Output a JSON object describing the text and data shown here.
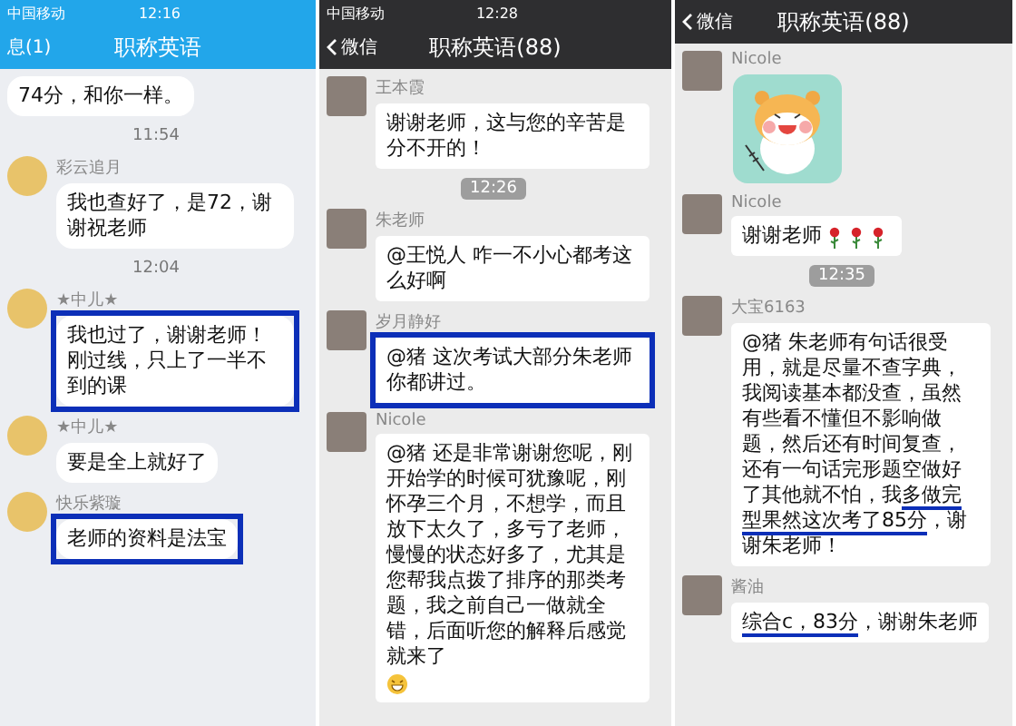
{
  "panels": [
    {
      "kind": "qq",
      "status_bar": {
        "carrier": "中国移动",
        "time": "12:16"
      },
      "header": {
        "back": "息(1)",
        "title": "职称英语"
      },
      "messages": [
        {
          "kind": "continued",
          "highlighted": false,
          "parts": [
            {
              "text": "74分，和你一样。",
              "underlined": false
            }
          ]
        },
        {
          "kind": "time",
          "text": "11:54"
        },
        {
          "kind": "text",
          "sender": "彩云追月",
          "highlighted": false,
          "parts": [
            {
              "text": "我也查好了，是72，谢谢祝老师",
              "underlined": false
            }
          ]
        },
        {
          "kind": "time",
          "text": "12:04"
        },
        {
          "kind": "text",
          "sender": "★中儿★",
          "highlighted": true,
          "parts": [
            {
              "text": "我也过了，谢谢老师！刚过线，只上了一半不到的课",
              "underlined": false
            }
          ]
        },
        {
          "kind": "text",
          "sender": "★中儿★",
          "highlighted": false,
          "parts": [
            {
              "text": "要是全上就好了",
              "underlined": false
            }
          ]
        },
        {
          "kind": "text",
          "sender": "快乐紫璇",
          "highlighted": true,
          "parts": [
            {
              "text": "老师的资料是法宝",
              "underlined": false
            }
          ]
        }
      ]
    },
    {
      "kind": "wechat",
      "status_bar": {
        "carrier": "中国移动",
        "time": "12:28"
      },
      "header": {
        "back": "微信",
        "title": "职称英语(88)"
      },
      "messages": [
        {
          "kind": "text",
          "sender": "王本霞",
          "highlighted": false,
          "parts": [
            {
              "text": "谢谢老师，这与您的辛苦是分不开的！",
              "underlined": false
            }
          ]
        },
        {
          "kind": "time",
          "text": "12:26"
        },
        {
          "kind": "text",
          "sender": "朱老师",
          "highlighted": false,
          "parts": [
            {
              "text": "@王悦人 咋一不小心都考这么好啊",
              "underlined": false
            }
          ]
        },
        {
          "kind": "text",
          "sender": "岁月静好",
          "highlighted": true,
          "parts": [
            {
              "text": "@猪 这次考试大部分朱老师你都讲过。",
              "underlined": false
            }
          ]
        },
        {
          "kind": "text",
          "sender": "Nicole",
          "highlighted": false,
          "trailing_icon": {
            "kind": "grin"
          },
          "parts": [
            {
              "text": "@猪 还是非常谢谢您呢，刚开始学的时候可犹豫呢，刚怀孕三个月，不想学，而且放下太久了，多亏了老师，慢慢的状态好多了，尤其是您帮我点拨了排序的那类考题，我之前自己一做就全错，后面听您的解释后感觉就来了",
              "underlined": false
            }
          ]
        }
      ]
    },
    {
      "kind": "wechat",
      "header": {
        "back": "微信",
        "title": "职称英语(88)"
      },
      "messages": [
        {
          "kind": "sticker",
          "sender": "Nicole"
        },
        {
          "kind": "text",
          "sender": "Nicole",
          "highlighted": false,
          "trailing_icon": {
            "kind": "roses"
          },
          "parts": [
            {
              "text": "谢谢老师",
              "underlined": false
            }
          ]
        },
        {
          "kind": "time",
          "text": "12:35"
        },
        {
          "kind": "text",
          "sender": "大宝6163",
          "highlighted": false,
          "parts": [
            {
              "text": "@猪 朱老师有句话很受用，就是尽量不查字典，我阅读基本都没查，虽然有些看不懂但不影响做题，然后还有时间复查，还有一句话完形题空做好了其他就不怕，我",
              "underlined": false
            },
            {
              "text": "多做完型果然这次考了85分",
              "underlined": true
            },
            {
              "text": "，谢谢朱老师！",
              "underlined": false
            }
          ]
        },
        {
          "kind": "text",
          "sender": "酱油",
          "highlighted": false,
          "parts": [
            {
              "text": "综合c，83分",
              "underlined": true
            },
            {
              "text": "，谢谢朱老师",
              "underlined": false
            }
          ]
        }
      ]
    }
  ]
}
